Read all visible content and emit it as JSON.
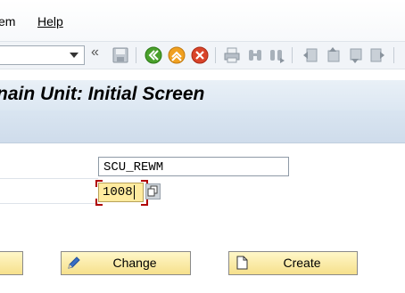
{
  "menu": {
    "system_tail": "em",
    "help": "Help"
  },
  "toolbar": {
    "nav_back_glyph": "«",
    "icons": [
      "save-icon",
      "back-icon",
      "exit-icon",
      "cancel-icon",
      "print-icon",
      "find-icon",
      "find-next-icon",
      "first-page-icon",
      "previous-page-icon",
      "next-page-icon",
      "last-page-icon"
    ]
  },
  "title": "nain Unit: Initial Screen",
  "fields": {
    "field1_value": "SCU_REWM",
    "field2_value": "1008"
  },
  "buttons": {
    "change": "Change",
    "create": "Create"
  },
  "colors": {
    "title_bg": "#dce7f2",
    "button_bg": "#f6e08c",
    "focus_field_bg": "#ffeb9f",
    "focus_marker": "#b00000"
  }
}
